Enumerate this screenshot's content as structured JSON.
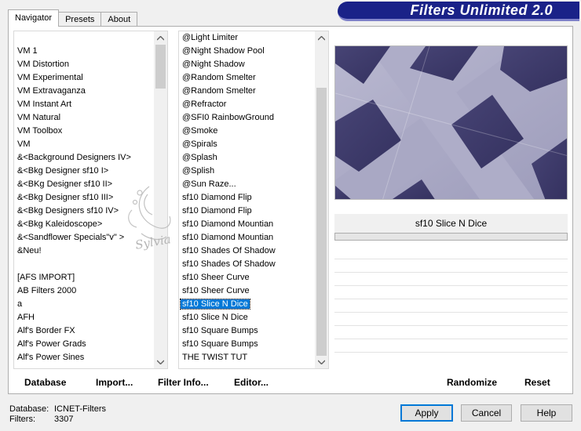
{
  "app": {
    "banner_title": "Filters Unlimited 2.0"
  },
  "tabs": [
    {
      "label": "Navigator",
      "active": true
    },
    {
      "label": "Presets",
      "active": false
    },
    {
      "label": "About",
      "active": false
    }
  ],
  "categories": [
    "VM 1",
    "VM Distortion",
    "VM Experimental",
    "VM Extravaganza",
    "VM Instant Art",
    "VM Natural",
    "VM Toolbox",
    "VM",
    "&<Background Designers IV>",
    "&<Bkg Designer sf10 I>",
    "&<BKg Designer sf10 II>",
    "&<Bkg Designer sf10 III>",
    "&<Bkg Designers sf10 IV>",
    "&<Bkg Kaleidoscope>",
    "&<Sandflower Specials\"v\" >",
    "&Neu!",
    "",
    "[AFS IMPORT]",
    "AB Filters 2000",
    "a",
    "AFH",
    "Alf's Border FX",
    "Alf's Power Grads",
    "Alf's Power Sines"
  ],
  "filters": [
    "@Light Limiter",
    "@Night Shadow Pool",
    "@Night Shadow",
    "@Random Smelter",
    "@Random Smelter",
    "@Refractor",
    "@SFI0 RainbowGround",
    "@Smoke",
    "@Spirals",
    "@Splash",
    "@Splish",
    "@Sun Raze...",
    "sf10 Diamond Flip",
    "sf10 Diamond Flip",
    "sf10 Diamond Mountian",
    "sf10 Diamond Mountian",
    "sf10 Shades Of Shadow",
    "sf10 Shades Of Shadow",
    "sf10 Sheer Curve",
    "sf10 Sheer Curve",
    "sf10 Slice N Dice",
    "sf10 Slice N Dice",
    "sf10 Square Bumps",
    "sf10 Square Bumps",
    "THE TWIST TUT"
  ],
  "selected_filter_index": 20,
  "watermark_text": "Sylvia",
  "preview": {
    "filter_name": "sf10 Slice N Dice"
  },
  "bottom_buttons": {
    "database": "Database",
    "import": "Import...",
    "filter_info": "Filter Info...",
    "editor": "Editor...",
    "randomize": "Randomize",
    "reset": "Reset"
  },
  "status": {
    "database_label": "Database:",
    "database_value": "ICNET-Filters",
    "filters_label": "Filters:",
    "filters_value": "3307"
  },
  "dialog_buttons": {
    "apply": "Apply",
    "cancel": "Cancel",
    "help": "Help"
  },
  "colors": {
    "banner": "#1a2288",
    "selection": "#0078d7",
    "tile_dark": "#3d3a6e",
    "tile_light": "#a8a7c3"
  },
  "icons": {
    "scroll_up": "chevron-up-icon",
    "scroll_down": "chevron-down-icon"
  }
}
